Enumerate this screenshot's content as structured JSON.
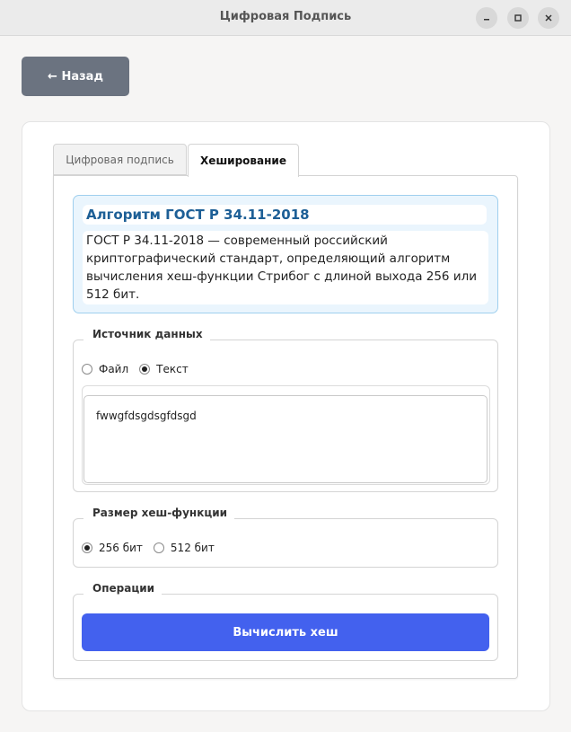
{
  "window": {
    "title": "Цифровая Подпись"
  },
  "back_button": {
    "label": "← Назад"
  },
  "tabs": [
    {
      "label": "Цифровая подпись",
      "active": false
    },
    {
      "label": "Хеширование",
      "active": true
    }
  ],
  "info": {
    "title": "Алгоритм ГОСТ Р 34.11-2018",
    "text": "ГОСТ Р 34.11-2018 — современный российский криптографический стандарт, определяющий алгоритм вычисления хеш-функции Стрибог с длиной выхода 256 или 512 бит."
  },
  "source_group": {
    "legend": "Источник данных",
    "options": [
      {
        "label": "Файл",
        "selected": false
      },
      {
        "label": "Текст",
        "selected": true
      }
    ],
    "text_value": "fwwgfdsgdsgfdsgd"
  },
  "size_group": {
    "legend": "Размер хеш-функции",
    "options": [
      {
        "label": "256 бит",
        "selected": true
      },
      {
        "label": "512 бит",
        "selected": false
      }
    ]
  },
  "operations_group": {
    "legend": "Операции",
    "compute_label": "Вычислить хеш"
  },
  "colors": {
    "primary": "#4361ee",
    "back_button": "#6b7380",
    "info_bg": "#eaf5fd",
    "info_border": "#9fcfee",
    "info_title": "#1d5f96"
  }
}
